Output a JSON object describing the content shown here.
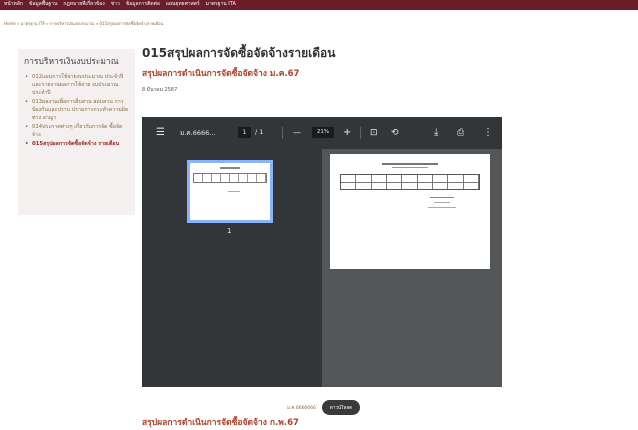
{
  "topnav": {
    "items": [
      "หน้าหลัก",
      "ข้อมูลพื้นฐาน",
      "กฎหมายที่เกี่ยวข้อง",
      "ข่าว",
      "ข้อมูลการติดต่อ",
      "แผนยุทธศาสตร์",
      "มาตรฐาน ITA"
    ]
  },
  "breadcrumb": {
    "items": [
      "Home",
      "มาตรฐาน ITA",
      "การบริหารเงินงบประมาณ",
      "015สรุปผลการจัดซื้อจัดจ้างรายเดือน"
    ],
    "separator": "»"
  },
  "sidebar": {
    "title": "การบริหารเงินงบประมาณ",
    "items": [
      {
        "label": "012แผนการใช้จ่ายงบประมาณ ประจำปีและรายงานผลการใช้จ่าย งบประมาณประจำปี",
        "active": false
      },
      {
        "label": "013ผลงานเพื่อการสืบสวน สอบสวน การป้องกันและปราบ ปรามการกระทำความผิดทาง อาญา",
        "active": false
      },
      {
        "label": "014ประกาศต่างๆ เกี่ยวกับการจัด ซื้อจัดจ้าง",
        "active": false
      },
      {
        "label": "015สรุปผลการจัดซื้อจัดจ้าง รายเดือน",
        "active": true
      }
    ]
  },
  "main": {
    "title": "015สรุปผลการจัดซื้อจัดจ้างรายเดือน",
    "section_title": "สรุปผลการดำเนินการจัดซื้อจัดจ้าง ม.ค.67",
    "date": "8 มีนาคม 2567",
    "section_title_2": "สรุปผลการดำเนินการจัดซื้อจัดจ้าง ก.พ.67"
  },
  "pdf_viewer": {
    "doc_title": "ม.ค.6666...",
    "current_page": "1",
    "page_total": "/ 1",
    "zoom_out": "—",
    "zoom": "21%",
    "zoom_in": "+",
    "thumbnail_page_number": "1",
    "icons": [
      "menu-icon",
      "fit-page-icon",
      "rotate-icon",
      "download-icon",
      "print-icon",
      "more-icon"
    ]
  },
  "file": {
    "name": "ม.ค.6666666",
    "download_label": "ดาวน์โหลด"
  },
  "colors": {
    "topbar": "#6b1d2a",
    "accent": "#b0402a",
    "viewer_toolbar": "#323639",
    "viewer_bg": "#525659"
  }
}
